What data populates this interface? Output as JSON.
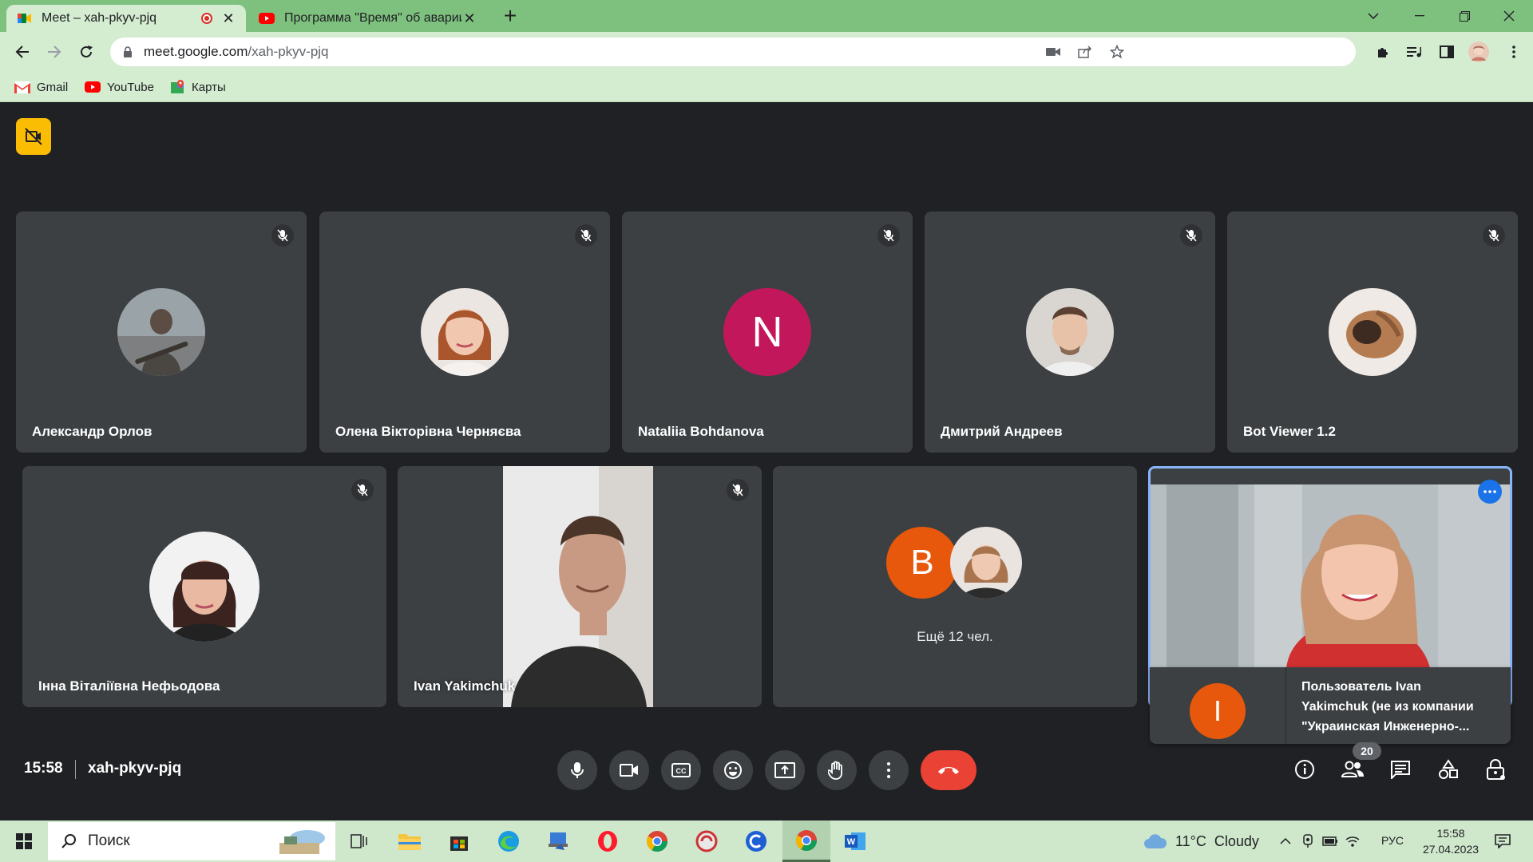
{
  "browser": {
    "tabs": [
      {
        "title": "Meet – xah-pkyv-pjq",
        "recording": true,
        "active": true
      },
      {
        "title": "Программа \"Время\" об аварии",
        "active": false
      }
    ],
    "url_host": "meet.google.com",
    "url_path": "/xah-pkyv-pjq",
    "bookmarks": [
      {
        "label": "Gmail",
        "icon": "gmail-icon"
      },
      {
        "label": "YouTube",
        "icon": "youtube-icon"
      },
      {
        "label": "Карты",
        "icon": "maps-icon"
      }
    ]
  },
  "meet": {
    "participants_row1": [
      {
        "name": "Александр Орлов",
        "avatar": "photo",
        "muted": true
      },
      {
        "name": "Олена Вікторівна Черняєва",
        "avatar": "photo",
        "muted": true
      },
      {
        "name": "Nataliia Bohdanova",
        "avatar": "letter",
        "letter": "N",
        "color": "#c2185b",
        "muted": true
      },
      {
        "name": "Дмитрий Андреев",
        "avatar": "photo",
        "muted": true
      },
      {
        "name": "Bot Viewer 1.2",
        "avatar": "photo",
        "muted": true
      }
    ],
    "participants_row2": [
      {
        "name": "Інна Віталіївна Нефьодова",
        "avatar": "photo",
        "muted": true
      },
      {
        "name": "Ivan Yakimchuk",
        "avatar": "video",
        "muted": true
      }
    ],
    "others": {
      "letter": "B",
      "label": "Ещё 12 чел."
    },
    "self_tile": {
      "letter": "I",
      "caption": "Пользователь Ivan Yakimchuk (не из компании \"Украинская Инженерно-...",
      "caption_lines": [
        "Пользователь Ivan",
        "Yakimchuk (не из компании",
        "\"Украинская Инженерно-..."
      ]
    },
    "time": "15:58",
    "meeting_code": "xah-pkyv-pjq",
    "people_count": "20",
    "colors": {
      "background": "#202124",
      "tile": "#3c4043",
      "end_call": "#ea4335",
      "accent": "#1a73e8"
    }
  },
  "taskbar": {
    "search_placeholder": "Поиск",
    "weather": "11°C  Cloudy",
    "language": "РУС",
    "time": "15:58",
    "date": "27.04.2023"
  }
}
